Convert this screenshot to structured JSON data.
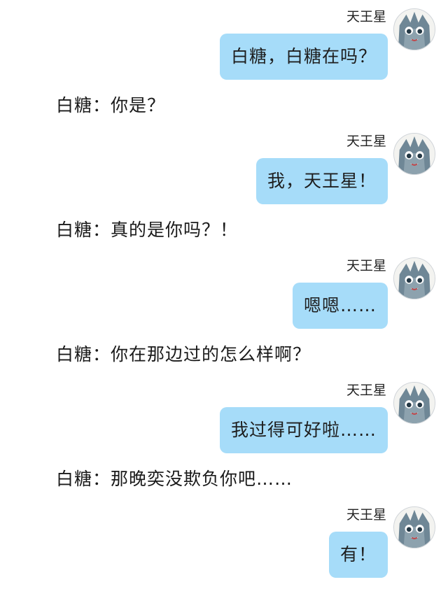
{
  "conversation": [
    {
      "sender": "天王星",
      "text": "白糖，白糖在吗？",
      "reply": "白糖：你是？"
    },
    {
      "sender": "天王星",
      "text": "我，天王星！",
      "reply": "白糖：真的是你吗？！"
    },
    {
      "sender": "天王星",
      "text": "嗯嗯……",
      "reply": "白糖：你在那边过的怎么样啊？"
    },
    {
      "sender": "天王星",
      "text": "我过得可好啦……",
      "reply": "白糖：那晚奕没欺负你吧……"
    },
    {
      "sender": "天王星",
      "text": "有！"
    }
  ],
  "colors": {
    "bubble": "#a6dcf9",
    "background": "#ffffff",
    "avatar_fur": "#6f8796"
  },
  "avatar_icon": "cat-mascot-avatar-icon"
}
